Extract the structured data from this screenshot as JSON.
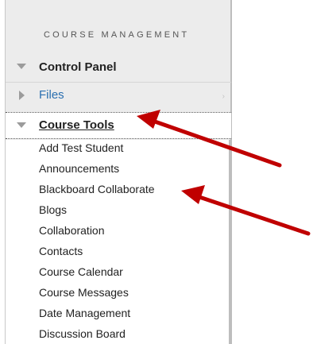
{
  "section": {
    "title": "COURSE MANAGEMENT"
  },
  "menu": {
    "control_panel": "Control Panel",
    "files": "Files",
    "course_tools": "Course Tools"
  },
  "tools": [
    "Add Test Student",
    "Announcements",
    "Blackboard Collaborate",
    "Blogs",
    "Collaboration",
    "Contacts",
    "Course Calendar",
    "Course Messages",
    "Date Management",
    "Discussion Board"
  ],
  "colors": {
    "annotation_arrow": "#c00000",
    "link": "#2a6fb0"
  }
}
